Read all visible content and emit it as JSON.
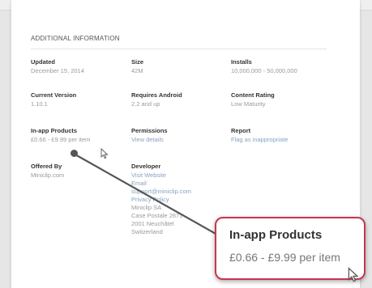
{
  "section_title": "ADDITIONAL INFORMATION",
  "fields": {
    "updated": {
      "label": "Updated",
      "value": "December 15, 2014"
    },
    "size": {
      "label": "Size",
      "value": "42M"
    },
    "installs": {
      "label": "Installs",
      "value": "10,000,000 - 50,000,000"
    },
    "current_version": {
      "label": "Current Version",
      "value": "1.10.1"
    },
    "requires_android": {
      "label": "Requires Android",
      "value": "2.2 and up"
    },
    "content_rating": {
      "label": "Content Rating",
      "value": "Low Maturity"
    },
    "in_app_products": {
      "label": "In-app Products",
      "value": "£0.66 - £9.99 per item"
    },
    "permissions": {
      "label": "Permissions",
      "value": "View details"
    },
    "report": {
      "label": "Report",
      "value": "Flag as inappropriate"
    },
    "offered_by": {
      "label": "Offered By",
      "value": "Miniclip.com"
    },
    "developer": {
      "label": "Developer",
      "visit_website": "Visit Website",
      "email_label": "Email",
      "email": "support@miniclip.com",
      "privacy_policy": "Privacy Policy",
      "address_lines": [
        "Miniclip SA",
        "Case Postale 2671",
        "2001 Neuchâtel",
        "Switzerland"
      ]
    }
  },
  "callout": {
    "title": "In-app Products",
    "value": "£0.66 - £9.99 per item"
  },
  "colors": {
    "callout_border": "#c8364c",
    "link": "#86a3c1",
    "muted_value": "#9a9a9a"
  }
}
